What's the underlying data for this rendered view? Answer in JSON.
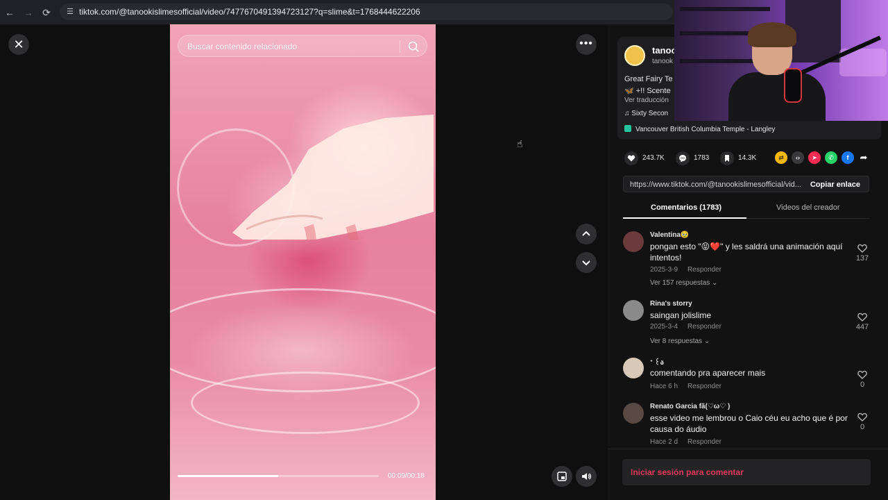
{
  "browser": {
    "url": "tiktok.com/@tanookislimesofficial/video/7477670491394723127?q=slime&t=1768444622206"
  },
  "video": {
    "search_placeholder": "Buscar contenido relacionado",
    "time": "00:09/00:18",
    "progress": 0.5
  },
  "creator": {
    "name": "tanoo",
    "handle": "tanook",
    "description_line1": "Great Fairy Te",
    "description_line2": "🦋 +!! Scente",
    "translate": "Ver traducción",
    "music": "♫ Sixty Secon",
    "location": "Vancouver British Columbia Temple - Langley"
  },
  "stats": {
    "likes": "243.7K",
    "comments": "1783",
    "saves": "14.3K"
  },
  "link": {
    "url": "https://www.tiktok.com/@tanookislimesofficial/vid...",
    "copy_label": "Copiar enlace"
  },
  "tabs": {
    "comments": "Comentarios (1783)",
    "creator_videos": "Videos del creador"
  },
  "comments": [
    {
      "user": "Valentina🥹",
      "text": "pongan esto \"😝❤️\" y les saldrá una animación aquí intentos!",
      "date": "2025-3-9",
      "reply_label": "Responder",
      "replies": "Ver 157 respuestas ⌄",
      "likes": "137",
      "avatar_color": "#6b3a3a"
    },
    {
      "user": "Rina's storry",
      "text": "saingan jolislime",
      "date": "2025-3-4",
      "reply_label": "Responder",
      "replies": "Ver 8 respuestas ⌄",
      "likes": "447",
      "avatar_color": "#8a8a8a"
    },
    {
      "user": "ᕀ ꒰ა",
      "text": "comentando pra aparecer mais",
      "date": "Hace 6 h",
      "reply_label": "Responder",
      "replies": "",
      "likes": "0",
      "avatar_color": "#d8c8b8"
    },
    {
      "user": "Renato Garcia fã(♡ω♡ )",
      "text": "esse video me lembrou o Caio céu eu acho que é por causa do áudio",
      "date": "Hace 2 d",
      "reply_label": "Responder",
      "replies": "",
      "likes": "0",
      "avatar_color": "#5a4a44"
    }
  ],
  "login_prompt": "Iniciar sesión para comentar",
  "colors": {
    "accent": "#e6395c",
    "panel_bg": "#121212",
    "video_pink": "#e7819d"
  }
}
